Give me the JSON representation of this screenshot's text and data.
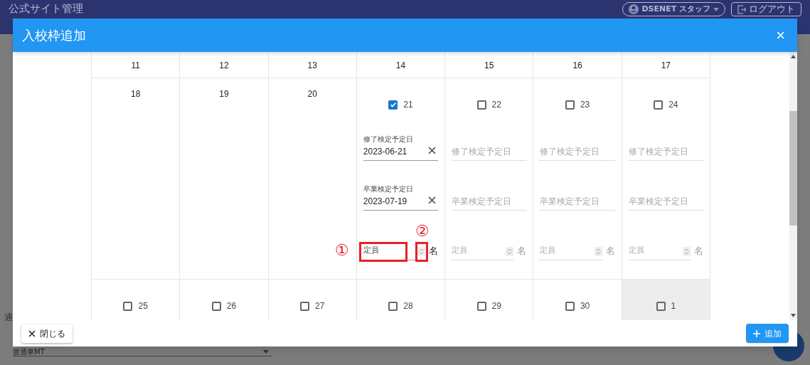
{
  "page": {
    "title": "公式サイト管理",
    "user_button": "DSENET スタッフ",
    "logout_button": "ログアウト",
    "field_label": "通",
    "select_value": "普通車MT"
  },
  "dialog": {
    "title": "入校枠追加",
    "close_icon": "×",
    "weeks": [
      {
        "days": [
          {
            "label": "11",
            "kind": "plain"
          },
          {
            "label": "12",
            "kind": "plain"
          },
          {
            "label": "13",
            "kind": "plain"
          },
          {
            "label": "14",
            "kind": "plain"
          },
          {
            "label": "15",
            "kind": "plain"
          },
          {
            "label": "16",
            "kind": "plain"
          },
          {
            "label": "17",
            "kind": "plain"
          }
        ]
      },
      {
        "days": [
          {
            "label": "18",
            "kind": "plain"
          },
          {
            "label": "19",
            "kind": "plain"
          },
          {
            "label": "20",
            "kind": "plain"
          },
          {
            "label": "21",
            "kind": "slot",
            "checked": true,
            "fields": [
              {
                "label": "修了検定予定日",
                "value": "2023-06-21"
              },
              {
                "label": "卒業検定予定日",
                "value": "2023-07-19"
              }
            ],
            "capacity": {
              "placeholder": "定員",
              "unit": "名",
              "annotations": [
                {
                  "kind": "input",
                  "mark": "①"
                },
                {
                  "kind": "spinner",
                  "mark": "②"
                }
              ]
            }
          },
          {
            "label": "22",
            "kind": "slot",
            "checked": false,
            "fields": [
              {
                "placeholder": "修了検定予定日"
              },
              {
                "placeholder": "卒業検定予定日"
              }
            ],
            "capacity": {
              "placeholder": "定員",
              "unit": "名"
            }
          },
          {
            "label": "23",
            "kind": "slot",
            "checked": false,
            "fields": [
              {
                "placeholder": "修了検定予定日"
              },
              {
                "placeholder": "卒業検定予定日"
              }
            ],
            "capacity": {
              "placeholder": "定員",
              "unit": "名"
            }
          },
          {
            "label": "24",
            "kind": "slot",
            "checked": false,
            "fields": [
              {
                "placeholder": "修了検定予定日"
              },
              {
                "placeholder": "卒業検定予定日"
              }
            ],
            "capacity": {
              "placeholder": "定員",
              "unit": "名"
            }
          }
        ]
      },
      {
        "days": [
          {
            "label": "25",
            "kind": "slot",
            "checked": false
          },
          {
            "label": "26",
            "kind": "slot",
            "checked": false
          },
          {
            "label": "27",
            "kind": "slot",
            "checked": false
          },
          {
            "label": "28",
            "kind": "slot",
            "checked": false
          },
          {
            "label": "29",
            "kind": "slot",
            "checked": false
          },
          {
            "label": "30",
            "kind": "slot",
            "checked": false
          },
          {
            "label": "1",
            "kind": "slot",
            "checked": false,
            "outside": true
          }
        ]
      }
    ],
    "close_button": "閉じる",
    "add_button": "追加"
  }
}
